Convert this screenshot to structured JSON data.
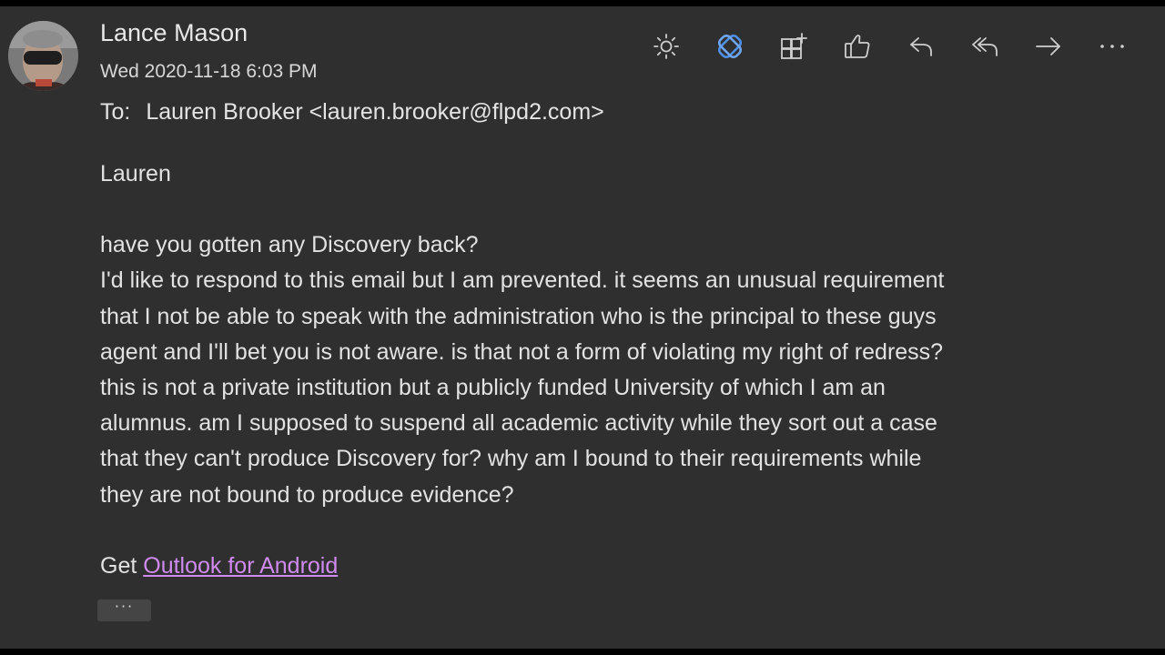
{
  "message": {
    "sender_name": "Lance Mason",
    "datetime": "Wed 2020-11-18 6:03 PM",
    "to_label": "To:",
    "to_recipient": "Lauren Brooker <lauren.brooker@flpd2.com>",
    "body": {
      "greeting": "Lauren",
      "lines": [
        "have you gotten any Discovery back?",
        "I'd like to respond to this email but I am prevented. it seems an unusual requirement",
        "that I not be able to speak with the administration who is the principal to these guys",
        "agent and I'll bet you is not aware. is that not a form of violating my right of redress?",
        "this is not a private institution but a publicly funded University of which I am an",
        "alumnus.  am I supposed to suspend all academic activity while they sort out a case",
        "that they can't produce Discovery for?  why am I bound to their requirements while",
        "they are not bound to produce evidence?"
      ],
      "signature_prefix": "Get",
      "signature_link": "Outlook for Android"
    },
    "show_more_label": "···"
  },
  "toolbar": [
    {
      "icon": "sun-icon"
    },
    {
      "icon": "loop-app-icon"
    },
    {
      "icon": "apps-add-icon"
    },
    {
      "icon": "thumbs-up-icon"
    },
    {
      "icon": "reply-icon"
    },
    {
      "icon": "reply-all-icon"
    },
    {
      "icon": "forward-icon"
    },
    {
      "icon": "more-actions-icon"
    }
  ],
  "colors": {
    "background": "#2f2f2f",
    "frame": "#000000",
    "text": "#e2e2e2",
    "link": "#d08bf0",
    "icon": "#cfcfcf",
    "accent_icon": "#4f8fe6"
  }
}
